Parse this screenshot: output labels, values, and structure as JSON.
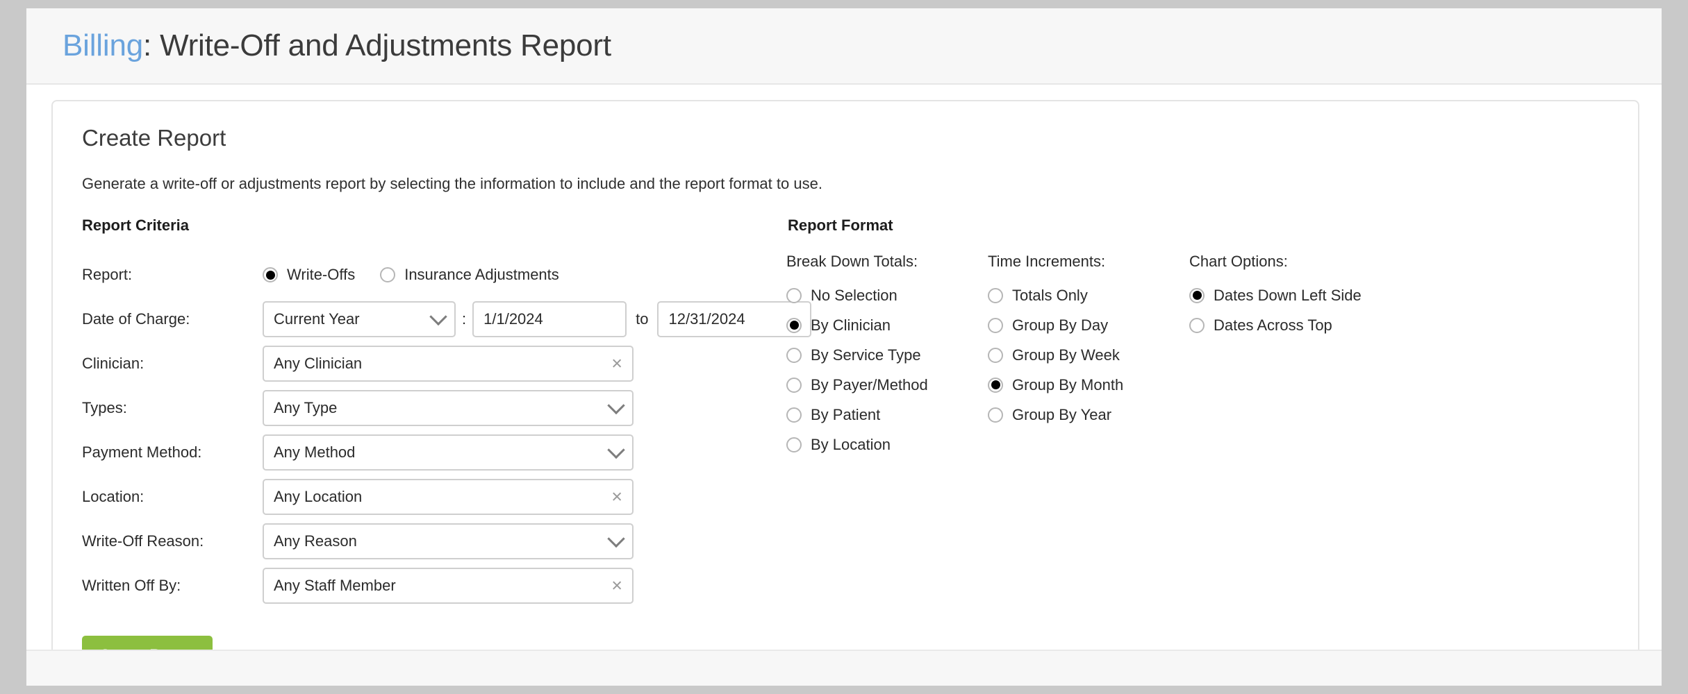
{
  "header": {
    "breadcrumb_link": "Billing",
    "separator": ": ",
    "title": "Write-Off and Adjustments Report"
  },
  "card": {
    "title": "Create Report",
    "description": "Generate a write-off or adjustments report by selecting the information to include and the report format to use."
  },
  "criteria": {
    "heading": "Report Criteria",
    "report": {
      "label": "Report:",
      "options": [
        {
          "label": "Write-Offs",
          "selected": true
        },
        {
          "label": "Insurance Adjustments",
          "selected": false
        }
      ]
    },
    "date_of_charge": {
      "label": "Date of Charge:",
      "range_value": "Current Year",
      "colon": ":",
      "from_value": "1/1/2024",
      "to_label": "to",
      "to_value": "12/31/2024"
    },
    "fields": [
      {
        "label": "Clinician:",
        "value": "Any Clinician",
        "affix": "clear-icon"
      },
      {
        "label": "Types:",
        "value": "Any Type",
        "affix": "chevron-down-icon"
      },
      {
        "label": "Payment Method:",
        "value": "Any Method",
        "affix": "chevron-down-icon"
      },
      {
        "label": "Location:",
        "value": "Any Location",
        "affix": "clear-icon"
      },
      {
        "label": "Write-Off Reason:",
        "value": "Any Reason",
        "affix": "chevron-down-icon"
      },
      {
        "label": "Written Off By:",
        "value": "Any Staff Member",
        "affix": "clear-icon"
      }
    ],
    "submit_label": "Create Report"
  },
  "format": {
    "heading": "Report Format",
    "break_down": {
      "heading": "Break Down Totals:",
      "options": [
        {
          "label": "No Selection",
          "selected": false
        },
        {
          "label": "By Clinician",
          "selected": true
        },
        {
          "label": "By Service Type",
          "selected": false
        },
        {
          "label": "By Payer/Method",
          "selected": false
        },
        {
          "label": "By Patient",
          "selected": false
        },
        {
          "label": "By Location",
          "selected": false
        }
      ]
    },
    "time_increments": {
      "heading": "Time Increments:",
      "options": [
        {
          "label": "Totals Only",
          "selected": false
        },
        {
          "label": "Group By Day",
          "selected": false
        },
        {
          "label": "Group By Week",
          "selected": false
        },
        {
          "label": "Group By Month",
          "selected": true
        },
        {
          "label": "Group By Year",
          "selected": false
        }
      ]
    },
    "chart_options": {
      "heading": "Chart Options:",
      "options": [
        {
          "label": "Dates Down Left Side",
          "selected": true
        },
        {
          "label": "Dates Across Top",
          "selected": false
        }
      ]
    }
  },
  "colors": {
    "accent_link": "#6aa3dd",
    "primary_button": "#8cbf3f",
    "page_background": "#f7f7f7"
  },
  "icons": {
    "clear": "×"
  }
}
